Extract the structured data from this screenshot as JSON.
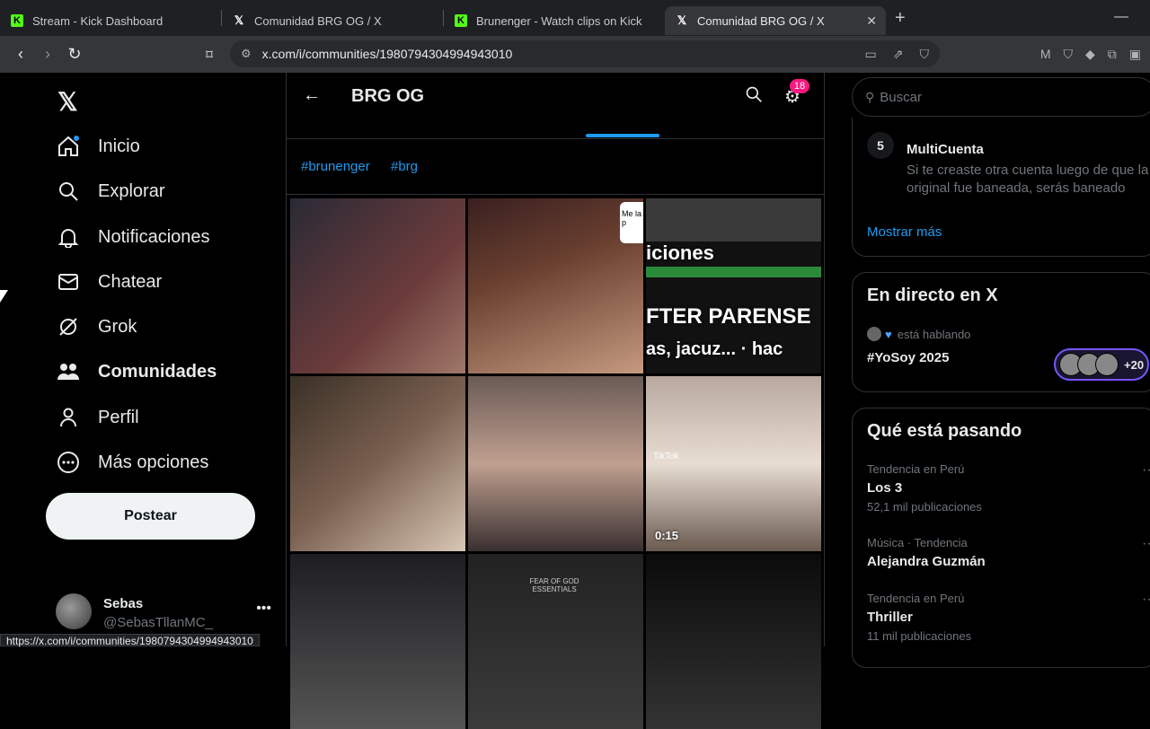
{
  "browser": {
    "tabs": [
      {
        "title": "Stream - Kick Dashboard",
        "icon": "kick-icon",
        "active": false
      },
      {
        "title": "Comunidad BRG OG / X",
        "icon": "x-icon",
        "active": false
      },
      {
        "title": "Brunenger - Watch clips on Kick",
        "icon": "kick-icon",
        "active": false
      },
      {
        "title": "Comunidad BRG OG / X",
        "icon": "x-icon",
        "active": true
      }
    ],
    "url": "x.com/i/communities/1980794304994943010",
    "status_url": "https://x.com/i/communities/1980794304994943010"
  },
  "nav": {
    "items": [
      {
        "label": "Inicio",
        "icon": "home-icon"
      },
      {
        "label": "Explorar",
        "icon": "search-icon"
      },
      {
        "label": "Notificaciones",
        "icon": "bell-icon"
      },
      {
        "label": "Chatear",
        "icon": "mail-icon"
      },
      {
        "label": "Grok",
        "icon": "grok-icon"
      },
      {
        "label": "Comunidades",
        "icon": "communities-icon"
      },
      {
        "label": "Perfil",
        "icon": "person-icon"
      },
      {
        "label": "Más opciones",
        "icon": "more-circle-icon"
      }
    ],
    "post_label": "Postear"
  },
  "account": {
    "name": "Sebas",
    "handle": "@SebasTllanMC_"
  },
  "community": {
    "title": "BRG OG",
    "notification_count": "18",
    "tags": [
      "#brunenger",
      "#brg"
    ],
    "media": [
      {
        "desc": "selfie",
        "colors": [
          "#2a2a35",
          "#6b3b3b"
        ]
      },
      {
        "desc": "boxing",
        "colors": [
          "#3a2020",
          "#c59a80"
        ],
        "overlay": "Me la p"
      },
      {
        "desc": "text-video",
        "colors": [
          "#111",
          "#222"
        ],
        "overlay_lines": [
          "iciones",
          "FTER PARENSE",
          "as, jacuz... · hac"
        ]
      },
      {
        "desc": "couple",
        "colors": [
          "#3a3026",
          "#d8c6b5"
        ]
      },
      {
        "desc": "group",
        "colors": [
          "#6a5a55",
          "#c0a090"
        ]
      },
      {
        "desc": "woman",
        "colors": [
          "#b8a8a0",
          "#e8ddd2"
        ],
        "tiktok": "TikTok",
        "duration": "0:15"
      },
      {
        "desc": "hand",
        "colors": [
          "#1e1e22",
          "#555"
        ]
      },
      {
        "desc": "hoodie",
        "colors": [
          "#222",
          "#3b3b3b"
        ],
        "overlay": "FEAR OF GOD ESSENTIALS"
      },
      {
        "desc": "night",
        "colors": [
          "#0b0b0b",
          "#333"
        ]
      }
    ]
  },
  "sidebar": {
    "search_placeholder": "Buscar",
    "rule": {
      "number": "5",
      "title": "MultiCuenta",
      "desc": "Si te creaste otra cuenta luego de que la original fue baneada, serás baneado"
    },
    "show_more": "Mostrar más",
    "live": {
      "title": "En directo en X",
      "speaking": "está hablando",
      "space": "#YoSoy 2025",
      "extra": "+20"
    },
    "trends_title": "Qué está pasando",
    "trends": [
      {
        "meta": "Tendencia en Perú",
        "name": "Los 3",
        "count": "52,1 mil publicaciones"
      },
      {
        "meta": "Música · Tendencia",
        "name": "Alejandra Guzmán",
        "count": ""
      },
      {
        "meta": "Tendencia en Perú",
        "name": "Thriller",
        "count": "11 mil publicaciones"
      }
    ]
  },
  "colors": {
    "accent": "#1d9bf0",
    "badge": "#f91880",
    "kick": "#53fc18"
  }
}
